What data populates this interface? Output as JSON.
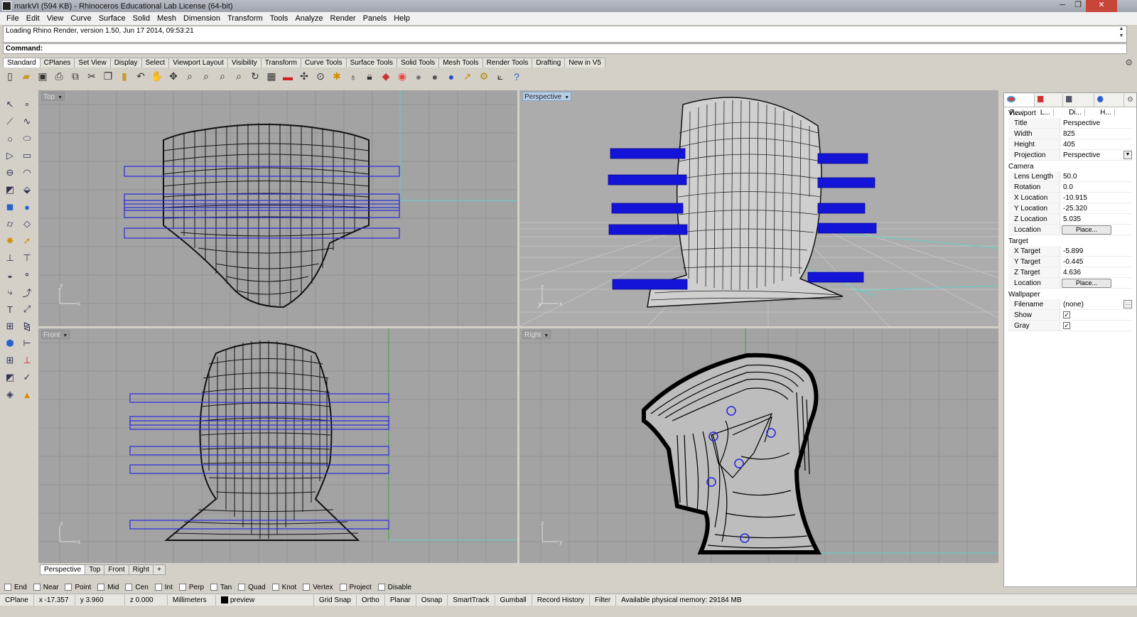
{
  "window": {
    "title": "markVI (594 KB) - Rhinoceros Educational Lab License (64-bit)",
    "min": "─",
    "max": "❐",
    "close": "✕"
  },
  "menu": [
    "File",
    "Edit",
    "View",
    "Curve",
    "Surface",
    "Solid",
    "Mesh",
    "Dimension",
    "Transform",
    "Tools",
    "Analyze",
    "Render",
    "Panels",
    "Help"
  ],
  "command": {
    "history": "Loading Rhino Render, version 1.50, Jun 17 2014, 09:53:21",
    "prompt": "Command:"
  },
  "toolbar_tabs": [
    "Standard",
    "CPlanes",
    "Set View",
    "Display",
    "Select",
    "Viewport Layout",
    "Visibility",
    "Transform",
    "Curve Tools",
    "Surface Tools",
    "Solid Tools",
    "Mesh Tools",
    "Render Tools",
    "Drafting",
    "New in V5"
  ],
  "toolbar_icons": [
    "new-icon",
    "open-icon",
    "save-icon",
    "print-icon",
    "import-icon",
    "cut-icon",
    "copy-icon",
    "paste-icon",
    "undo-icon",
    "pan-icon",
    "rotate-icon",
    "zoom-icon",
    "zoom-window-icon",
    "zoom-extents-icon",
    "zoom-selected-icon",
    "zoom-dynamic-icon",
    "grid-icon",
    "shade-icon",
    "light-icon",
    "point-icon",
    "properties-icon",
    "bulb-icon",
    "lock-icon",
    "layer-icon",
    "color-wheel-icon",
    "material-icon",
    "render-icon",
    "sphere-icon",
    "arrow-icon",
    "gear-icon",
    "cplane-icon",
    "help-icon"
  ],
  "viewports": {
    "top": {
      "label": "Top",
      "axis_x": "x",
      "axis_y": "y"
    },
    "perspective": {
      "label": "Perspective",
      "axis_x": "x",
      "axis_y": "y",
      "axis_z": "z"
    },
    "front": {
      "label": "Front",
      "axis_x": "x",
      "axis_z": "z"
    },
    "right": {
      "label": "Right",
      "axis_y": "y",
      "axis_z": "z"
    }
  },
  "viewport_tabs": [
    "Perspective",
    "Top",
    "Front",
    "Right",
    "+"
  ],
  "osnaps": [
    "End",
    "Near",
    "Point",
    "Mid",
    "Cen",
    "Int",
    "Perp",
    "Tan",
    "Quad",
    "Knot",
    "Vertex",
    "Project",
    "Disable"
  ],
  "status": {
    "cplane": "CPlane",
    "x": "x -17.357",
    "y": "y 3.960",
    "z": "z 0.000",
    "units": "Millimeters",
    "layer": "preview",
    "items": [
      "Grid Snap",
      "Ortho",
      "Planar",
      "Osnap",
      "SmartTrack",
      "Gumball",
      "Record History",
      "Filter"
    ],
    "memory": "Available physical memory: 29184 MB"
  },
  "panel": {
    "tabs": [
      "P...",
      "L...",
      "Di...",
      "H..."
    ],
    "viewport_header": "Viewport",
    "title_k": "Title",
    "title_v": "Perspective",
    "width_k": "Width",
    "width_v": "825",
    "height_k": "Height",
    "height_v": "405",
    "projection_k": "Projection",
    "projection_v": "Perspective",
    "camera_header": "Camera",
    "lens_k": "Lens Length",
    "lens_v": "50.0",
    "rotation_k": "Rotation",
    "rotation_v": "0.0",
    "xloc_k": "X Location",
    "xloc_v": "-10.915",
    "yloc_k": "Y Location",
    "yloc_v": "-25.320",
    "zloc_k": "Z Location",
    "zloc_v": "5.035",
    "location_k": "Location",
    "place": "Place...",
    "target_header": "Target",
    "xt_k": "X Target",
    "xt_v": "-5.899",
    "yt_k": "Y Target",
    "yt_v": "-0.445",
    "zt_k": "Z Target",
    "zt_v": "4.636",
    "location2_k": "Location",
    "wallpaper_header": "Wallpaper",
    "filename_k": "Filename",
    "filename_v": "(none)",
    "show_k": "Show",
    "gray_k": "Gray",
    "check": "✓"
  }
}
